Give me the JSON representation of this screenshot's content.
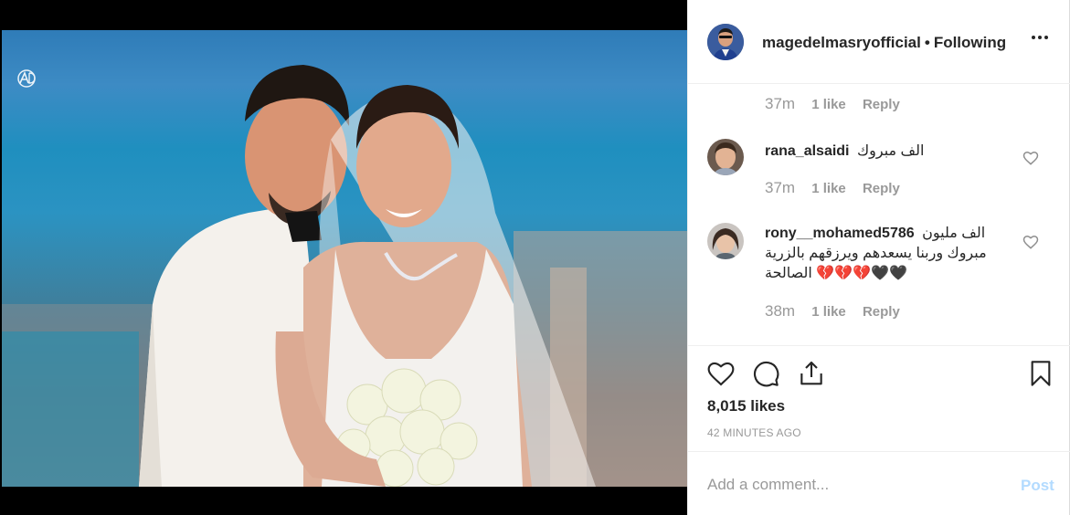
{
  "header": {
    "username": "magedelmasryofficial",
    "separator": "•",
    "follow_status": "Following",
    "more_icon": "more-horizontal-icon"
  },
  "comments": {
    "top_meta": {
      "time": "37m",
      "likes": "1 like",
      "reply": "Reply"
    },
    "items": [
      {
        "username": "rana_alsaidi",
        "text": "الف مبروك",
        "time": "37m",
        "likes": "1 like",
        "reply": "Reply"
      },
      {
        "username": "rony__mohamed5786",
        "text": "الف مليون مبروك وربنا يسعدهم ويرزقهم بالزرية الصالحة 💔💔💔🖤🖤",
        "time": "38m",
        "likes": "1 like",
        "reply": "Reply"
      }
    ]
  },
  "actions": {
    "like_icon": "heart-icon",
    "comment_icon": "comment-bubble-icon",
    "share_icon": "share-icon",
    "save_icon": "bookmark-icon",
    "likes_count": "8,015 likes",
    "timestamp": "42 MINUTES AGO"
  },
  "add_comment": {
    "placeholder": "Add a comment...",
    "post_label": "Post"
  },
  "colors": {
    "link_disabled": "#b3dbff",
    "secondary_text": "#999999",
    "primary_text": "#262626",
    "border": "#efefef"
  }
}
